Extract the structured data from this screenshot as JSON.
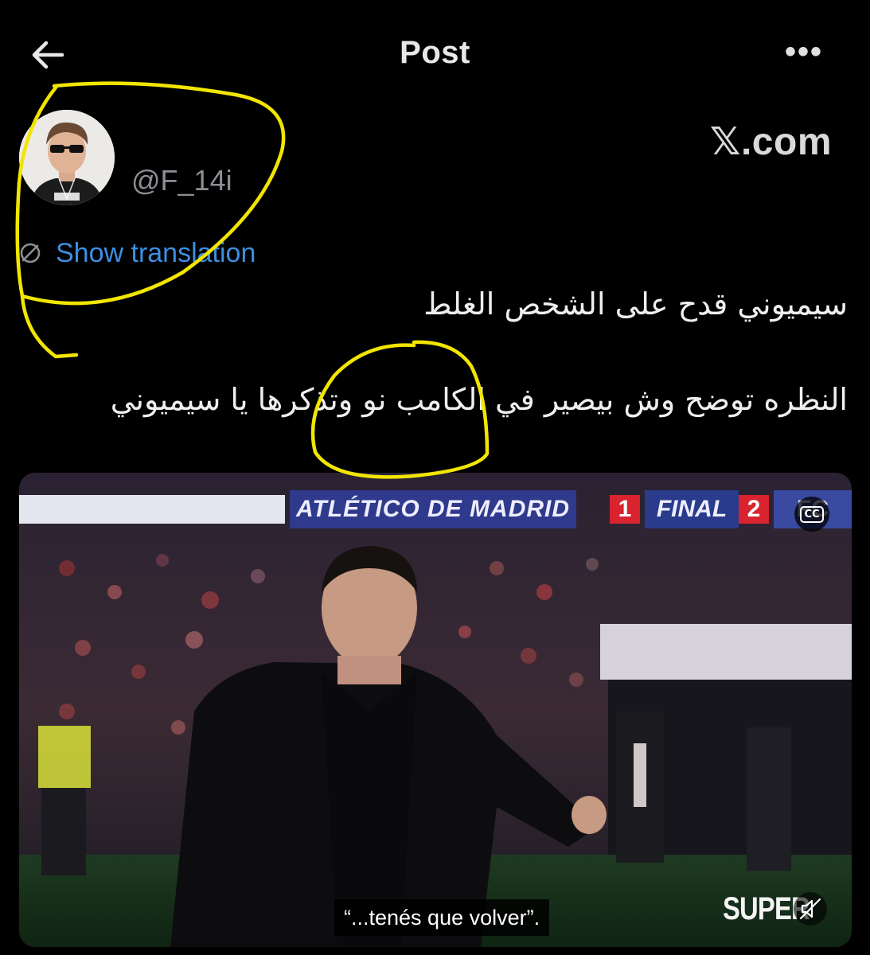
{
  "header": {
    "title": "Post",
    "back_icon": "arrow-left-icon",
    "more_icon": "ellipsis-icon",
    "more_glyph": "•••"
  },
  "author": {
    "handle": "@F_14i",
    "avatar_icon": "user-avatar"
  },
  "watermark": "𝕏.com",
  "translation": {
    "label": "Show translation",
    "icon": "globe-icon"
  },
  "post": {
    "line1": "سيميوني قدح على الشخص الغلط",
    "line2": "النظره توضح وش بيصير في الكامب نو وتذكرها يا سيميوني"
  },
  "media": {
    "scoreboard": {
      "team": "ATLÉTICO DE MADRID",
      "score_home": "1",
      "period": "FINAL",
      "score_away": "2",
      "away_abbr": "FC"
    },
    "cc_label": "CC",
    "subtitle": "“...tenés que volver”.",
    "brand": "SUPER",
    "mute_icon": "mute-icon"
  },
  "colors": {
    "background": "#000000",
    "link": "#3d8fe3",
    "annotation": "#f2e600"
  }
}
